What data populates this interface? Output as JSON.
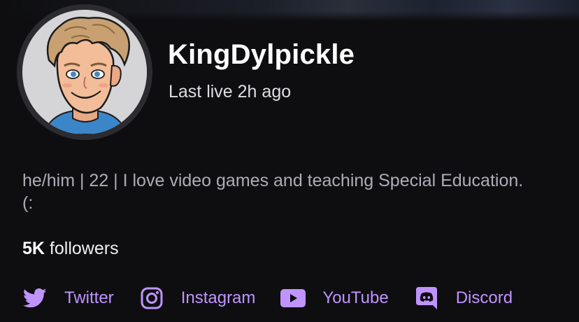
{
  "profile": {
    "display_name": "KingDylpickle",
    "last_live": "Last live 2h ago",
    "bio": "he/him | 22 | I love video games and teaching Special Education. (:",
    "followers_count": "5K",
    "followers_label": "followers"
  },
  "socials": [
    {
      "label": "Twitter",
      "icon": "twitter-icon"
    },
    {
      "label": "Instagram",
      "icon": "instagram-icon"
    },
    {
      "label": "YouTube",
      "icon": "youtube-icon"
    },
    {
      "label": "Discord",
      "icon": "discord-icon"
    }
  ],
  "colors": {
    "background": "#0e0e10",
    "accent": "#bf94ff",
    "text_primary": "#ffffff",
    "text_secondary": "#adadb8"
  }
}
